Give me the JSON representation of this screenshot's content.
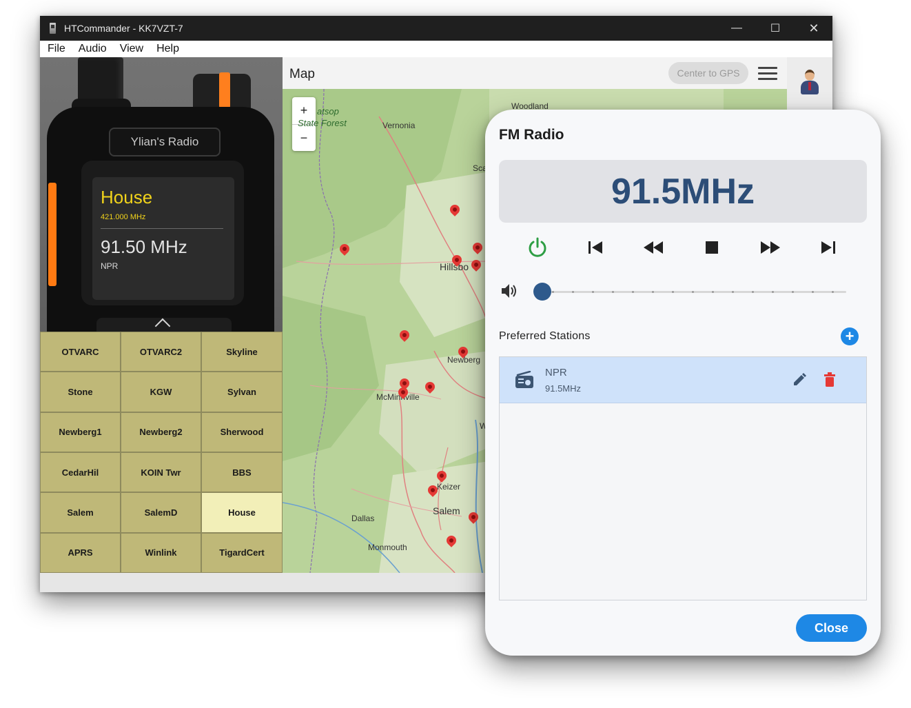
{
  "window": {
    "title": "HTCommander - KK7VZT-7",
    "controls": {
      "minimize": "—",
      "maximize": "☐",
      "close": "✕"
    }
  },
  "menu": [
    "File",
    "Audio",
    "View",
    "Help"
  ],
  "radio": {
    "brand": "Ylian's Radio",
    "channel_name": "House",
    "channel_freq": "421.000 MHz",
    "fm_freq": "91.50 MHz",
    "fm_station": "NPR"
  },
  "channels": [
    "OTVARC",
    "OTVARC2",
    "Skyline",
    "Stone",
    "KGW",
    "Sylvan",
    "Newberg1",
    "Newberg2",
    "Sherwood",
    "CedarHil",
    "KOIN Twr",
    "BBS",
    "Salem",
    "SalemD",
    "House",
    "APRS",
    "Winlink",
    "TigardCert"
  ],
  "active_channel": "House",
  "map": {
    "title": "Map",
    "center_gps": "Center to GPS",
    "zoom_in": "+",
    "zoom_out": "−",
    "labels": {
      "forest1": "atsop",
      "forest2": "State Forest",
      "vernonia": "Vernonia",
      "woodland": "Woodland",
      "hillsboro": "Hillsbo",
      "newberg": "Newberg",
      "mcminnville": "McMinnville",
      "keizer": "Keizer",
      "salem": "Salem",
      "dallas": "Dallas",
      "monmouth": "Monmouth",
      "sca": "Sca",
      "w": "W"
    }
  },
  "fm_dialog": {
    "title": "FM Radio",
    "frequency": "91.5MHz",
    "volume": 0.0,
    "preferred_label": "Preferred Stations",
    "add_symbol": "+",
    "stations": [
      {
        "name": "NPR",
        "freq": "91.5MHz"
      }
    ],
    "close_label": "Close",
    "colors": {
      "accent": "#1e88e5",
      "power": "#2e9e44",
      "delete": "#e53935",
      "freq_text": "#2c4d77"
    }
  }
}
